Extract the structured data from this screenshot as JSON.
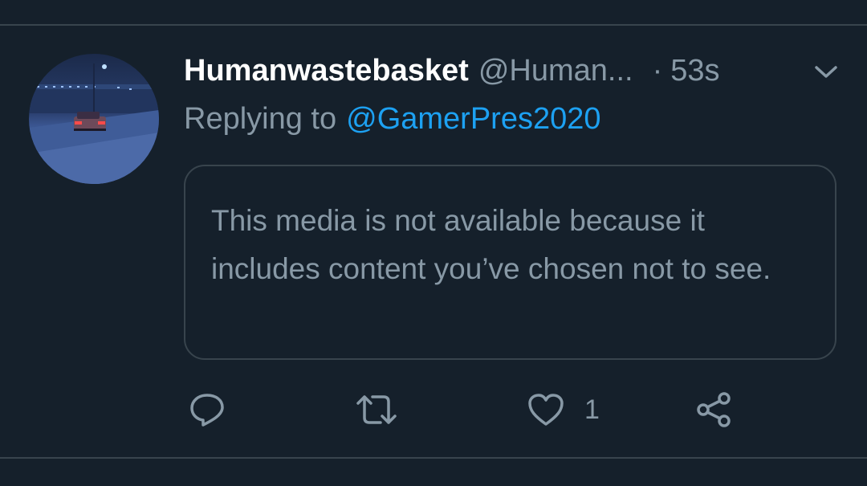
{
  "tweet": {
    "display_name": "Humanwastebasket",
    "handle": "@Human...",
    "separator": "·",
    "timestamp": "53s",
    "reply_prefix": "Replying to",
    "reply_to": "@GamerPres2020",
    "media_notice": "This media is not available because it includes content you’ve chosen not to see.",
    "likes_count": "1"
  },
  "icons": {
    "more": "chevron-down-icon",
    "reply": "reply-icon",
    "retweet": "retweet-icon",
    "like": "heart-icon",
    "share": "share-icon"
  },
  "colors": {
    "background": "#15202b",
    "divider": "#38444d",
    "primary_text": "#ffffff",
    "secondary_text": "#8899a6",
    "accent": "#1da1f2"
  }
}
